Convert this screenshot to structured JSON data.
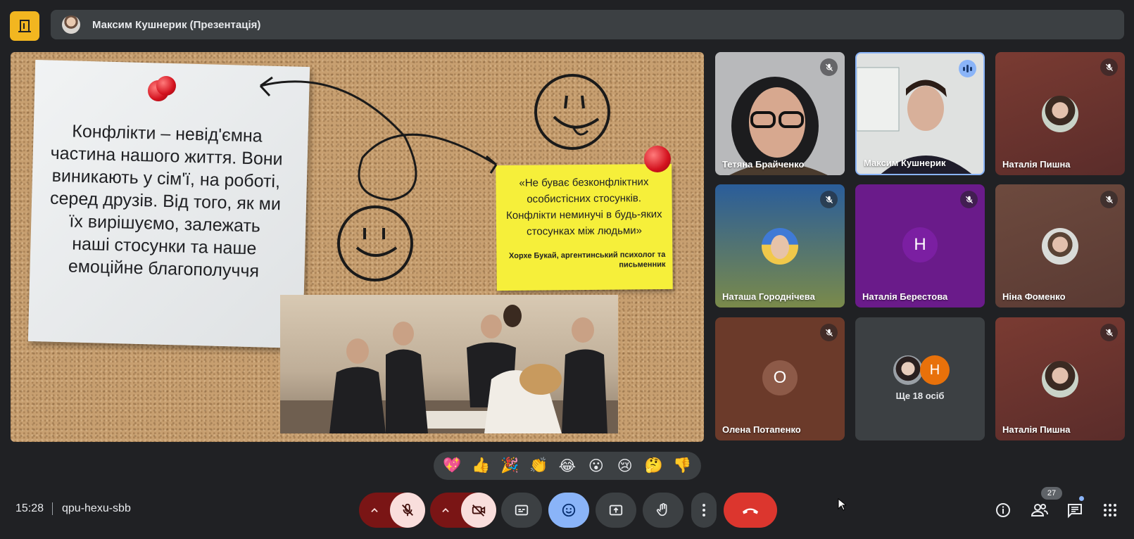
{
  "header": {
    "presenter_label": "Максим Кушнерик (Презентація)"
  },
  "slide": {
    "note_text": "Конфлікти – невід'ємна частина нашого життя. Вони виникають у сім'ї, на роботі, серед друзів. Від того, як ми їх вирішуємо, залежать наші стосунки та наше емоційне благополуччя",
    "quote_text": "«Не буває безконфліктних особистісних стосунків. Конфлікти неминучі в будь-яких стосунках між людьми»",
    "quote_author": "Хорхе Букай, аргентинський психолог та письменник"
  },
  "participants": [
    {
      "name": "Тетяна Брайченко",
      "muted": true
    },
    {
      "name": "Максим Кушнерик",
      "speaking": true
    },
    {
      "name": "Наталія Пишна",
      "muted": true
    },
    {
      "name": "Наташа Городнічева",
      "muted": true
    },
    {
      "name": "Наталія Берестова",
      "muted": true,
      "initial": "Н",
      "tile_color": "#6a1b8a",
      "avatar_color": "#7b1fa2"
    },
    {
      "name": "Ніна Фоменко",
      "muted": true
    },
    {
      "name": "Олена Потапенко",
      "muted": true,
      "initial": "О",
      "tile_color": "#6b3a2a",
      "avatar_color": "#8d5a48"
    },
    {
      "more_label": "Ще 18 осіб",
      "initial": "Н",
      "avatar_color": "#e8710a"
    },
    {
      "name": "Наталія Пишна",
      "muted": true
    }
  ],
  "reactions": [
    "💖",
    "👍",
    "🎉",
    "👏",
    "😂",
    "😮",
    "😢",
    "🤔",
    "👎"
  ],
  "footer": {
    "time": "15:28",
    "meeting_code": "qpu-hexu-sbb",
    "participant_count": "27"
  },
  "icons": {
    "app_logo": "door-exit-icon",
    "mic": "mic-off-icon",
    "camera": "camera-off-icon",
    "captions": "captions-icon",
    "emoji": "emoji-icon",
    "present": "present-screen-icon",
    "hand": "raise-hand-icon",
    "more": "more-options-icon",
    "end_call": "end-call-icon",
    "info": "info-icon",
    "people": "people-icon",
    "chat": "chat-icon",
    "activities": "apps-grid-icon"
  },
  "colors": {
    "background": "#202124",
    "end_call": "#dc362e",
    "active_control": "#8ab4f8",
    "muted_control": "#f9dedc",
    "accent_logo": "#f2b620"
  }
}
